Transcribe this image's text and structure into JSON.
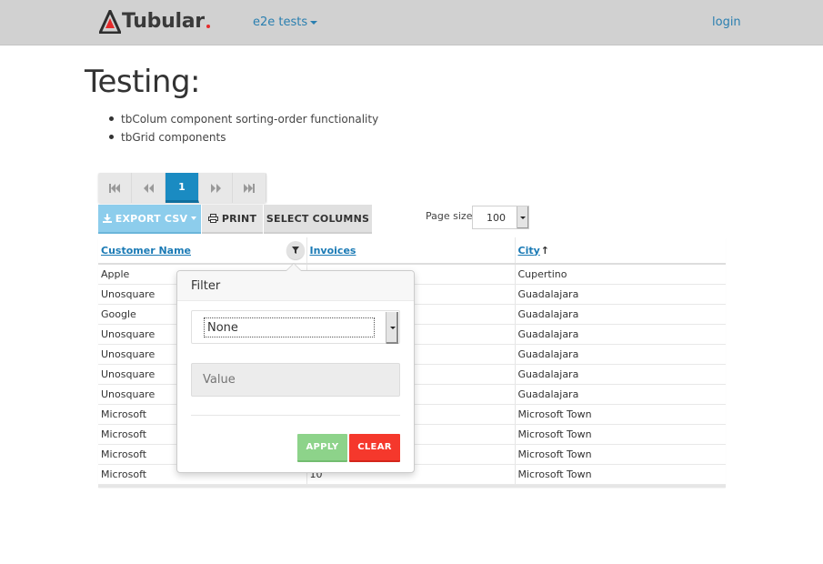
{
  "navbar": {
    "brand": "Tubular",
    "menu_label": "e2e tests",
    "login_label": "login"
  },
  "page": {
    "title": "Testing:",
    "bullets": [
      "tbColum component sorting-order functionality",
      "tbGrid components"
    ]
  },
  "pager": {
    "current_page": "1"
  },
  "toolbar": {
    "export_label": "EXPORT CSV",
    "print_label": "PRINT",
    "select_columns_label": "SELECT COLUMNS",
    "page_size_label": "Page size:",
    "page_size_value": "100"
  },
  "grid": {
    "columns": [
      "Customer Name",
      "Invoices",
      "City"
    ],
    "sort_indicator": "↑",
    "rows": [
      [
        "Apple",
        "",
        "Cupertino"
      ],
      [
        "Unosquare",
        "",
        "Guadalajara"
      ],
      [
        "Google",
        "",
        "Guadalajara"
      ],
      [
        "Unosquare",
        "",
        "Guadalajara"
      ],
      [
        "Unosquare",
        "",
        "Guadalajara"
      ],
      [
        "Unosquare",
        "",
        "Guadalajara"
      ],
      [
        "Unosquare",
        "",
        "Guadalajara"
      ],
      [
        "Microsoft",
        "",
        "Microsoft Town"
      ],
      [
        "Microsoft",
        "",
        "Microsoft Town"
      ],
      [
        "Microsoft",
        "",
        "Microsoft Town"
      ],
      [
        "Microsoft",
        "10",
        "Microsoft Town"
      ]
    ]
  },
  "filter": {
    "title": "Filter",
    "operator_value": "None",
    "value_placeholder": "Value",
    "apply_label": "APPLY",
    "clear_label": "CLEAR"
  },
  "colors": {
    "navbar_bg": "#d1d1d1",
    "link": "#2a7fb0",
    "active_page": "#1a8bc2",
    "export_button": "#8dcdec",
    "apply_button": "#8dd38a",
    "clear_button": "#f5382c",
    "logo_red": "#e52b2b"
  },
  "icons": [
    "logo-icon",
    "first-page-icon",
    "previous-page-icon",
    "next-page-icon",
    "last-page-icon",
    "download-icon",
    "print-icon",
    "filter-icon",
    "sort-up-icon",
    "dropdown-arrow-icon"
  ]
}
